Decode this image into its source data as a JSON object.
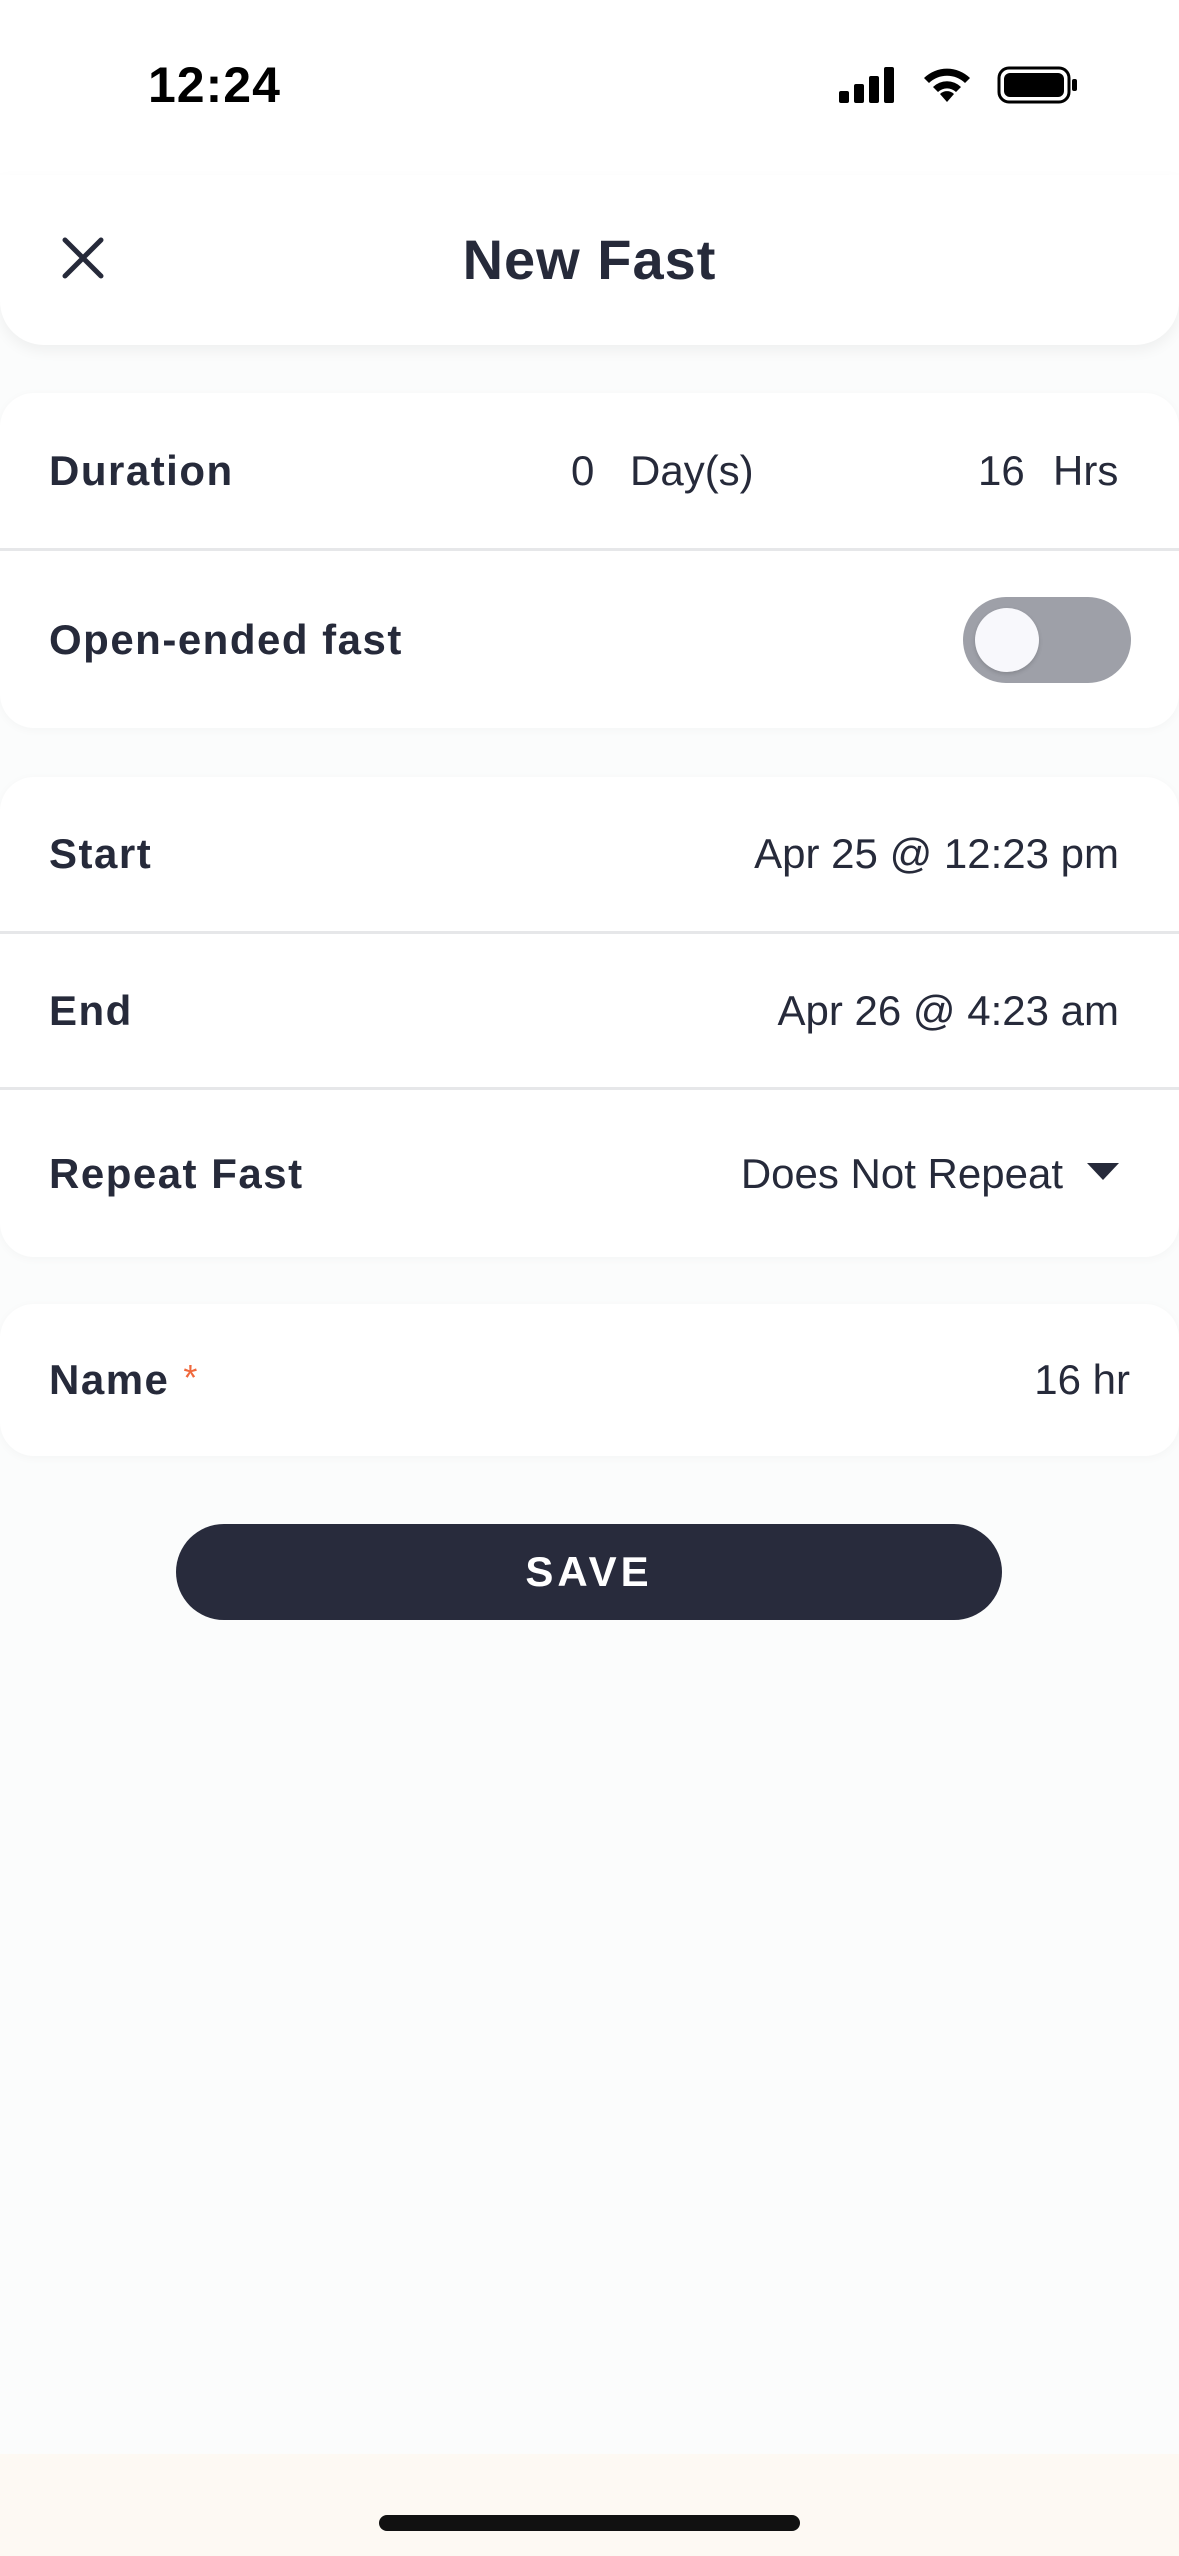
{
  "status_bar": {
    "time": "12:24"
  },
  "header": {
    "title": "New Fast",
    "close_icon": "close-icon"
  },
  "duration_card": {
    "duration_label": "Duration",
    "days_value": "0",
    "days_unit": "Day(s)",
    "hours_value": "16",
    "hours_unit": "Hrs",
    "open_ended_label": "Open-ended fast",
    "open_ended_enabled": false
  },
  "schedule_card": {
    "start_label": "Start",
    "start_value": "Apr 25 @ 12:23 pm",
    "end_label": "End",
    "end_value": "Apr 26 @ 4:23 am",
    "repeat_label": "Repeat Fast",
    "repeat_value": "Does Not Repeat"
  },
  "name_card": {
    "name_label": "Name",
    "required_marker": "*",
    "name_value": "16 hr"
  },
  "actions": {
    "save_label": "SAVE"
  },
  "colors": {
    "primary_dark": "#282b3c",
    "required_accent": "#f0683c",
    "toggle_off": "#9ea0a8",
    "background": "#fbfcfc"
  }
}
